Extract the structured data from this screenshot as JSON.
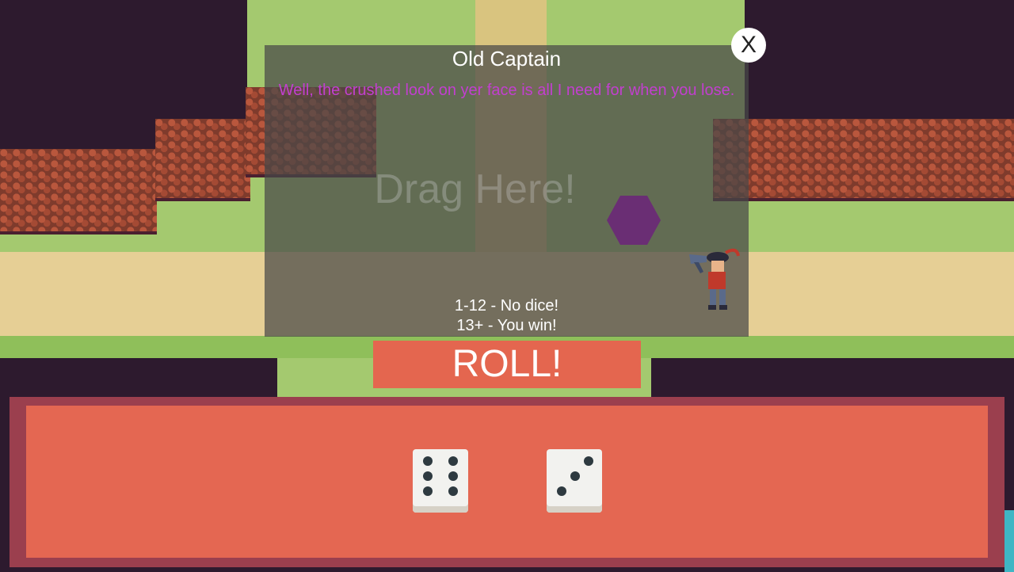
{
  "dialog": {
    "npc_name": "Old Captain",
    "npc_line": "Well, the crushed look on yer face is all I need for when you lose.",
    "drop_hint": "Drag Here!",
    "rules": [
      "1-12 - No dice!",
      "13+ - You win!"
    ],
    "close_label": "X"
  },
  "roll_button": {
    "label": "ROLL!"
  },
  "dice": [
    {
      "value": 6
    },
    {
      "value": 3
    }
  ],
  "colors": {
    "panel": "#e46752",
    "panel_border": "#9b3f4e",
    "npc_text": "#c23fcf",
    "drop_target": "#6a2e74"
  }
}
